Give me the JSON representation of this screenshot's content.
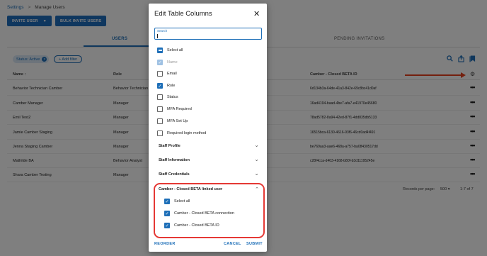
{
  "breadcrumb": {
    "parent": "Settings",
    "separator": ">",
    "current": "Manage Users"
  },
  "toolbar": {
    "invite_label": "INVITE USER",
    "bulk_label": "BULK INVITE USERS"
  },
  "tabs": {
    "users": "USERS",
    "pending": "PENDING INVITATIONS"
  },
  "filters": {
    "chip_label": "Status: Active",
    "chip_close": "×",
    "add_filter_label": "+ Add filter"
  },
  "table": {
    "headers": {
      "name": "Name ↑",
      "role": "Role",
      "beta_id": "Camber - Closed BETA ID"
    },
    "rows": [
      {
        "name": "Behavior Technician Camber",
        "role": "Behavior Technician",
        "beta_id": "6d134b3a-64de-41a3-842e-69c8bc41d0af"
      },
      {
        "name": "Camber Manager",
        "role": "Manager",
        "beta_id": "16ad4194-baad-4be7-afa7-e41970e45680"
      },
      {
        "name": "Emil Test2",
        "role": "Manager",
        "beta_id": "78ad5782-8a94-42ed-87f1-4dd835db5133"
      },
      {
        "name": "Jamie Camber Staging",
        "role": "Manager",
        "beta_id": "16515bca-6130-4616-93f6-46cd0ad4f491"
      },
      {
        "name": "Jenna Staging Camber",
        "role": "Manager",
        "beta_id": "be769aa3-aae6-468a-a757-ba08430517dd"
      },
      {
        "name": "Mathilde BA",
        "role": "Behavior Analyst",
        "beta_id": "c28f4cca-d403-4168-b80f-b3d11195245e"
      },
      {
        "name": "Shara Camber Testing",
        "role": "Manager",
        "beta_id": ""
      }
    ],
    "row_menu": "•••",
    "pagination": {
      "records_label": "Records per page:",
      "per_page": "500",
      "per_page_caret": "▾",
      "range": "1-7 of 7"
    }
  },
  "modal": {
    "title": "Edit Table Columns",
    "close": "✕",
    "search_label": "Search",
    "options": [
      {
        "label": "Select all",
        "state": "indeterminate"
      },
      {
        "label": "Name",
        "state": "checked-disabled"
      },
      {
        "label": "Email",
        "state": "unchecked"
      },
      {
        "label": "Role",
        "state": "checked"
      },
      {
        "label": "Status",
        "state": "unchecked"
      },
      {
        "label": "MFA Required",
        "state": "unchecked"
      },
      {
        "label": "MFA Set Up",
        "state": "unchecked"
      },
      {
        "label": "Required login method",
        "state": "unchecked"
      }
    ],
    "sections": [
      {
        "label": "Staff Profile",
        "expanded": false
      },
      {
        "label": "Staff Information",
        "expanded": false
      },
      {
        "label": "Staff Credentials",
        "expanded": false
      },
      {
        "label": "Camber - Closed BETA linked user",
        "expanded": true
      }
    ],
    "linked_options": [
      {
        "label": "Select all",
        "state": "checked"
      },
      {
        "label": "Camber - Closed BETA connection",
        "state": "checked"
      },
      {
        "label": "Camber - Closed BETA ID",
        "state": "checked"
      }
    ],
    "footer": {
      "reorder": "REORDER",
      "cancel": "CANCEL",
      "submit": "SUBMIT"
    }
  },
  "colors": {
    "accent": "#1e6fb8",
    "highlight": "#e53935",
    "arrow": "#e8401c"
  },
  "icons": [
    "search-icon",
    "share-icon",
    "bookmark-icon",
    "gear-icon",
    "close-icon",
    "chevron-down-icon",
    "chevron-up-icon"
  ]
}
